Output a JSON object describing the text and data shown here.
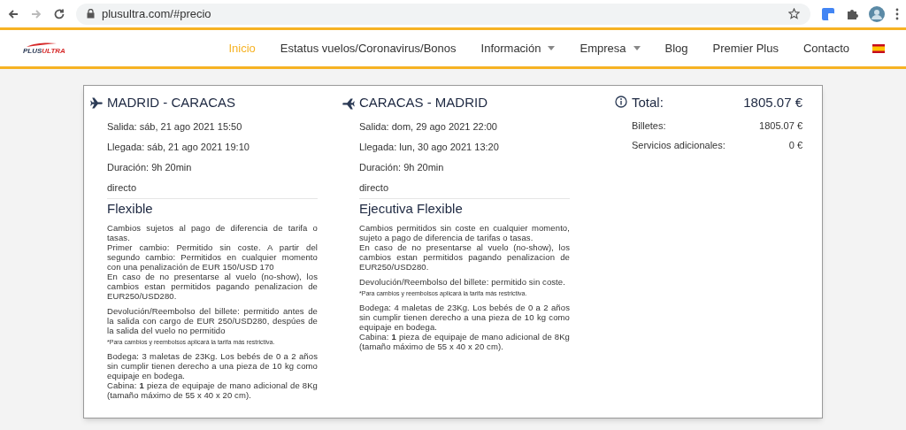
{
  "browser": {
    "url": "plusultra.com/#precio"
  },
  "nav": {
    "logo": {
      "part_1": "PLUS",
      "part_2": "ULTRA"
    },
    "items": [
      {
        "label": "Inicio",
        "selected": true,
        "dropdown": false
      },
      {
        "label": "Estatus vuelos/Coronavirus/Bonos",
        "selected": false,
        "dropdown": false
      },
      {
        "label": "Información",
        "selected": false,
        "dropdown": true
      },
      {
        "label": "Empresa",
        "selected": false,
        "dropdown": true
      },
      {
        "label": "Blog",
        "selected": false,
        "dropdown": false
      },
      {
        "label": "Premier Plus",
        "selected": false,
        "dropdown": false
      },
      {
        "label": "Contacto",
        "selected": false,
        "dropdown": false
      }
    ]
  },
  "flights": [
    {
      "kind": "outbound",
      "route": "MADRID - CARACAS",
      "details": [
        "Salida: sáb, 21 ago 2021 15:50",
        "Llegada: sáb, 21 ago 2021 19:10",
        "Duración: 9h 20min",
        "directo"
      ],
      "fare": "Flexible",
      "blocks": [
        {
          "kind": "text",
          "lines": [
            "Cambios sujetos al pago de diferencia de tarifa o tasas.",
            "Primer cambio: Permitido sin coste. A partir del segundo cambio: Permitidos en cualquier momento con una penalización de EUR 150/USD 170",
            "En caso de no presentarse al vuelo (no-show), los cambios estan permitidos pagando penalizacion de EUR250/USD280."
          ]
        },
        {
          "kind": "text",
          "lines": [
            "Devolución/Reembolso del billete: permitido antes de la salida con cargo de EUR 250/USD280, despúes de la salida del vuelo no permitido"
          ]
        },
        {
          "kind": "note",
          "lines": [
            "*Para cambios y reembolsos aplicará la tarifa más restrictiva."
          ]
        },
        {
          "kind": "text",
          "lines": [
            "Bodega: 3 maletas de 23Kg. Los bebés de 0 a 2 años sin cumplir tienen derecho a una pieza de 10 kg como equipaje en bodega.",
            "Cabina: **1** pieza de equipaje de mano adicional de 8Kg (tamaño máximo de 55 x 40 x 20 cm)."
          ]
        }
      ]
    },
    {
      "kind": "return",
      "route": "CARACAS - MADRID",
      "details": [
        "Salida: dom, 29 ago 2021 22:00",
        "Llegada: lun, 30 ago 2021 13:20",
        "Duración: 9h 20min",
        "directo"
      ],
      "fare": "Ejecutiva Flexible",
      "blocks": [
        {
          "kind": "text",
          "lines": [
            "Cambios permitidos sin coste en cualquier momento, sujeto a pago de diferencia de tarifas o tasas.",
            "En caso de no presentarse al vuelo (no-show), los cambios estan permitidos pagando penalizacion de EUR250/USD280."
          ]
        },
        {
          "kind": "text",
          "lines": [
            "Devolución/Reembolso del billete: permitido sin coste."
          ]
        },
        {
          "kind": "note",
          "lines": [
            "*Para cambios y reembolsos aplicará la tarifa más restrictiva."
          ]
        },
        {
          "kind": "text",
          "lines": [
            "Bodega: 4 maletas de 23Kg. Los bebés de 0 a 2 años sin cumplir tienen derecho a una pieza de 10 kg como equipaje en bodega.",
            "Cabina: **1** pieza de equipaje de mano adicional de 8Kg (tamaño máximo de 55 x 40 x 20 cm)."
          ]
        }
      ]
    }
  ],
  "summary": {
    "total_label": "Total:",
    "total": "1805.07 €",
    "rows": [
      {
        "label": "Billetes:",
        "value": "1805.07 €"
      },
      {
        "label": "Servicios adicionales:",
        "value": "0 €"
      }
    ]
  }
}
